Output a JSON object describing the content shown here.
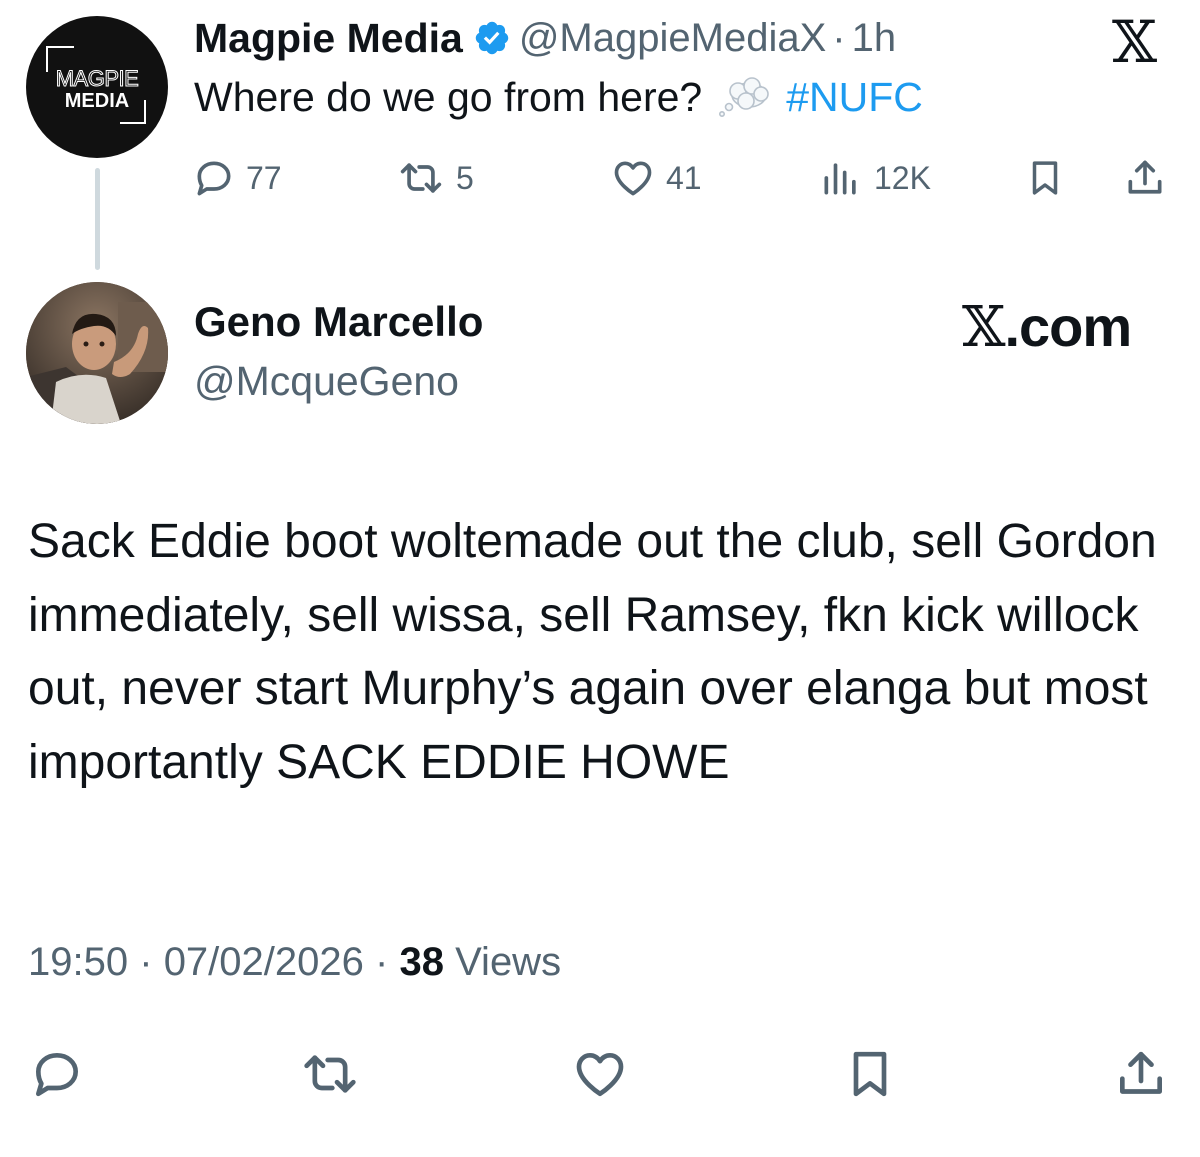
{
  "parent_tweet": {
    "avatar_logo_line1": "MAGPIE",
    "avatar_logo_line2": "MEDIA",
    "display_name": "Magpie Media",
    "handle": "@MagpieMediaX",
    "separator": "·",
    "time": "1h",
    "text": "Where do we go from here?",
    "thought_icon": "thought-balloon-icon",
    "hashtag": "#NUFC",
    "x_logo_icon": "x-logo-icon",
    "metrics": {
      "replies": "77",
      "reposts": "5",
      "likes": "41",
      "views": "12K"
    }
  },
  "reply_tweet": {
    "display_name": "Geno Marcello",
    "handle": "@McqueGeno",
    "x_watermark_glyph": "𝕏",
    "x_watermark_suffix": ".com",
    "body": "Sack Eddie boot woltemade out the club, sell Gordon immediately, sell wissa, sell Ramsey, fkn kick willock out, never start Murphy’s again over elanga but most importantly SACK EDDIE HOWE",
    "time": "19:50",
    "dot1": "·",
    "date": "07/02/2026",
    "dot2": "·",
    "views_count": "38",
    "views_label": "Views"
  },
  "colors": {
    "text_primary": "#0f1419",
    "text_secondary": "#536471",
    "accent_blue": "#1d9bf0",
    "thread_line": "#cfd9de"
  }
}
